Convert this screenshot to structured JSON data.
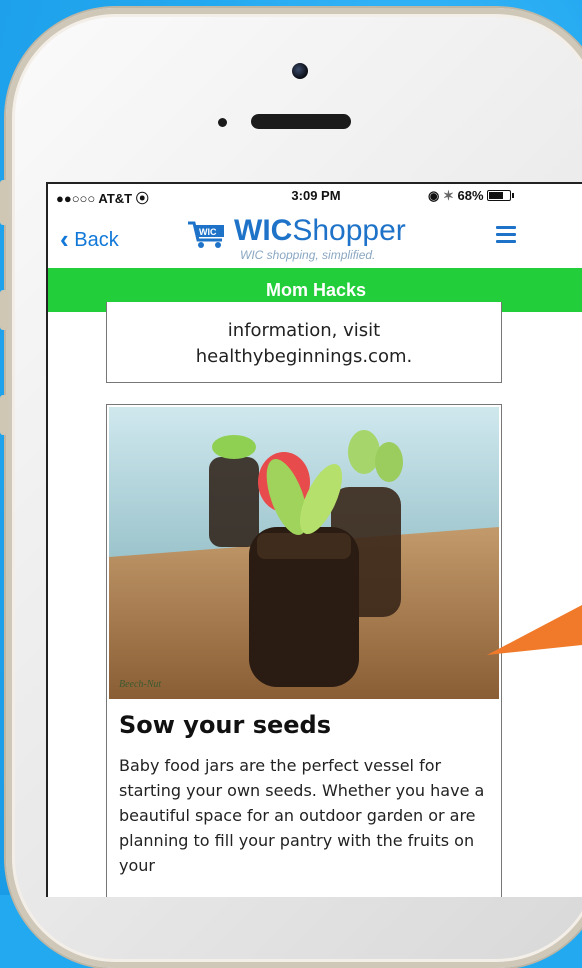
{
  "status_bar": {
    "carrier": "●●○○○ AT&T",
    "time": "3:09 PM",
    "battery": "68%"
  },
  "nav": {
    "back_label": "Back",
    "logo_title_bold": "WIC",
    "logo_title_rest": "Shopper",
    "logo_badge": "WIC",
    "logo_tagline": "WIC shopping, simplified.",
    "menu_icon": "hamburger-icon"
  },
  "header": {
    "title": "Mom Hacks"
  },
  "cards": {
    "previous_line1": "information, visit",
    "previous_line2": "healthybeginnings.com.",
    "current_title": "Sow your seeds",
    "current_body": "Baby food jars are the perfect vessel for starting your own seeds. Whether you have a beautiful space for an outdoor garden or are planning to fill your pantry with the fruits on your",
    "image_watermark": "Beech-Nut"
  },
  "colors": {
    "background": "#23a9f0",
    "brand_blue": "#1e73c9",
    "header_green": "#22cf3a",
    "back_blue": "#1178d8",
    "pointer_orange": "#f07a2a"
  }
}
